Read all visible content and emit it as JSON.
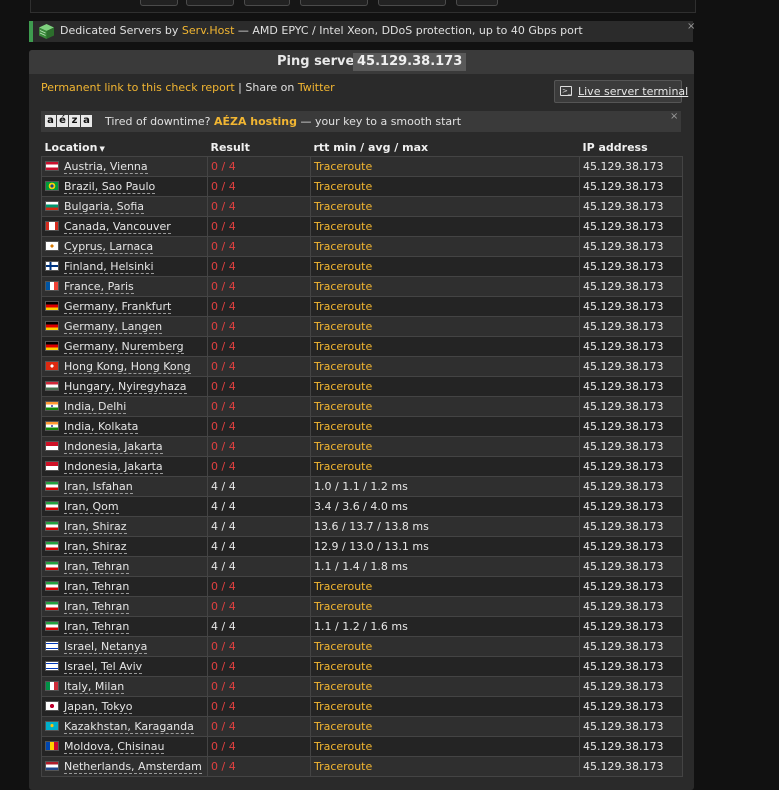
{
  "ad": {
    "prefix": "Dedicated Servers by ",
    "brand": "Serv.Host",
    "suffix": " — AMD EPYC / Intel Xeon, DDoS protection, up to 40 Gbps port",
    "close": "×"
  },
  "panel": {
    "title": "Ping server",
    "host": "45.129.38.173"
  },
  "permalink": {
    "link_label": "Permanent link to this check report",
    "sep": " | Share on ",
    "twitter_label": "Twitter"
  },
  "terminal": {
    "label": "Live server terminal",
    "icon": "terminal-icon"
  },
  "aeza": {
    "logo_letters": [
      "a",
      "é",
      "z",
      "a"
    ],
    "prefix": "Tired of downtime? ",
    "brand": "AÉZA hosting",
    "suffix": " — your key to a smooth start",
    "close": "×"
  },
  "table": {
    "headers": {
      "location": "Location",
      "result": "Result",
      "rtt": "rtt min / avg / max",
      "ip": "IP address"
    },
    "rows": [
      {
        "location": "Austria, Vienna",
        "flag": "at",
        "result": "0 / 4",
        "ok": false,
        "rtt": "Traceroute",
        "ip": "45.129.38.173"
      },
      {
        "location": "Brazil, Sao Paulo",
        "flag": "br",
        "result": "0 / 4",
        "ok": false,
        "rtt": "Traceroute",
        "ip": "45.129.38.173"
      },
      {
        "location": "Bulgaria, Sofia",
        "flag": "bg",
        "result": "0 / 4",
        "ok": false,
        "rtt": "Traceroute",
        "ip": "45.129.38.173"
      },
      {
        "location": "Canada, Vancouver",
        "flag": "ca",
        "result": "0 / 4",
        "ok": false,
        "rtt": "Traceroute",
        "ip": "45.129.38.173"
      },
      {
        "location": "Cyprus, Larnaca",
        "flag": "cy",
        "result": "0 / 4",
        "ok": false,
        "rtt": "Traceroute",
        "ip": "45.129.38.173"
      },
      {
        "location": "Finland, Helsinki",
        "flag": "fi",
        "result": "0 / 4",
        "ok": false,
        "rtt": "Traceroute",
        "ip": "45.129.38.173"
      },
      {
        "location": "France, Paris",
        "flag": "fr",
        "result": "0 / 4",
        "ok": false,
        "rtt": "Traceroute",
        "ip": "45.129.38.173"
      },
      {
        "location": "Germany, Frankfurt",
        "flag": "de",
        "result": "0 / 4",
        "ok": false,
        "rtt": "Traceroute",
        "ip": "45.129.38.173"
      },
      {
        "location": "Germany, Langen",
        "flag": "de",
        "result": "0 / 4",
        "ok": false,
        "rtt": "Traceroute",
        "ip": "45.129.38.173"
      },
      {
        "location": "Germany, Nuremberg",
        "flag": "de",
        "result": "0 / 4",
        "ok": false,
        "rtt": "Traceroute",
        "ip": "45.129.38.173"
      },
      {
        "location": "Hong Kong, Hong Kong",
        "flag": "hk",
        "result": "0 / 4",
        "ok": false,
        "rtt": "Traceroute",
        "ip": "45.129.38.173"
      },
      {
        "location": "Hungary, Nyiregyhaza",
        "flag": "hu",
        "result": "0 / 4",
        "ok": false,
        "rtt": "Traceroute",
        "ip": "45.129.38.173"
      },
      {
        "location": "India, Delhi",
        "flag": "in",
        "result": "0 / 4",
        "ok": false,
        "rtt": "Traceroute",
        "ip": "45.129.38.173"
      },
      {
        "location": "India, Kolkata",
        "flag": "in",
        "result": "0 / 4",
        "ok": false,
        "rtt": "Traceroute",
        "ip": "45.129.38.173"
      },
      {
        "location": "Indonesia, Jakarta",
        "flag": "id",
        "result": "0 / 4",
        "ok": false,
        "rtt": "Traceroute",
        "ip": "45.129.38.173"
      },
      {
        "location": "Indonesia, Jakarta",
        "flag": "id",
        "result": "0 / 4",
        "ok": false,
        "rtt": "Traceroute",
        "ip": "45.129.38.173"
      },
      {
        "location": "Iran, Isfahan",
        "flag": "ir",
        "result": "4 / 4",
        "ok": true,
        "rtt": "1.0 / 1.1 / 1.2 ms",
        "ip": "45.129.38.173"
      },
      {
        "location": "Iran, Qom",
        "flag": "ir",
        "result": "4 / 4",
        "ok": true,
        "rtt": "3.4 / 3.6 / 4.0 ms",
        "ip": "45.129.38.173"
      },
      {
        "location": "Iran, Shiraz",
        "flag": "ir",
        "result": "4 / 4",
        "ok": true,
        "rtt": "13.6 / 13.7 / 13.8 ms",
        "ip": "45.129.38.173"
      },
      {
        "location": "Iran, Shiraz",
        "flag": "ir",
        "result": "4 / 4",
        "ok": true,
        "rtt": "12.9 / 13.0 / 13.1 ms",
        "ip": "45.129.38.173"
      },
      {
        "location": "Iran, Tehran",
        "flag": "ir",
        "result": "4 / 4",
        "ok": true,
        "rtt": "1.1 / 1.4 / 1.8 ms",
        "ip": "45.129.38.173"
      },
      {
        "location": "Iran, Tehran",
        "flag": "ir",
        "result": "0 / 4",
        "ok": false,
        "rtt": "Traceroute",
        "ip": "45.129.38.173"
      },
      {
        "location": "Iran, Tehran",
        "flag": "ir",
        "result": "0 / 4",
        "ok": false,
        "rtt": "Traceroute",
        "ip": "45.129.38.173"
      },
      {
        "location": "Iran, Tehran",
        "flag": "ir",
        "result": "4 / 4",
        "ok": true,
        "rtt": "1.1 / 1.2 / 1.6 ms",
        "ip": "45.129.38.173"
      },
      {
        "location": "Israel, Netanya",
        "flag": "il",
        "result": "0 / 4",
        "ok": false,
        "rtt": "Traceroute",
        "ip": "45.129.38.173"
      },
      {
        "location": "Israel, Tel Aviv",
        "flag": "il",
        "result": "0 / 4",
        "ok": false,
        "rtt": "Traceroute",
        "ip": "45.129.38.173"
      },
      {
        "location": "Italy, Milan",
        "flag": "it",
        "result": "0 / 4",
        "ok": false,
        "rtt": "Traceroute",
        "ip": "45.129.38.173"
      },
      {
        "location": "Japan, Tokyo",
        "flag": "jp",
        "result": "0 / 4",
        "ok": false,
        "rtt": "Traceroute",
        "ip": "45.129.38.173"
      },
      {
        "location": "Kazakhstan, Karaganda",
        "flag": "kz",
        "result": "0 / 4",
        "ok": false,
        "rtt": "Traceroute",
        "ip": "45.129.38.173"
      },
      {
        "location": "Moldova, Chisinau",
        "flag": "md",
        "result": "0 / 4",
        "ok": false,
        "rtt": "Traceroute",
        "ip": "45.129.38.173"
      },
      {
        "location": "Netherlands, Amsterdam",
        "flag": "nl",
        "result": "0 / 4",
        "ok": false,
        "rtt": "Traceroute",
        "ip": "45.129.38.173"
      }
    ]
  },
  "colors": {
    "accent_link": "#f2b632",
    "fail": "#e04040",
    "background": "#111111",
    "panel": "#2a2a2a"
  }
}
